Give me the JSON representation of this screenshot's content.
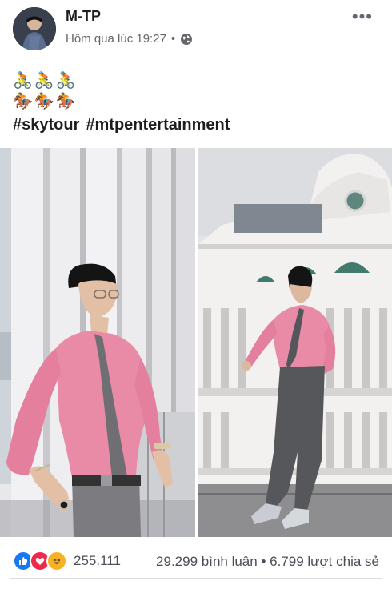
{
  "post": {
    "author": "M-TP",
    "timestamp": "Hôm qua lúc 19:27",
    "separator": "•",
    "privacy_icon": "globe-icon",
    "more_icon": "more-icon",
    "more_label": "•••",
    "emoji_line_1": "🚴🚴🚴",
    "emoji_line_2": "🏇🏇🏇",
    "hashtags": [
      "#skytour",
      "#mtpentertainment"
    ]
  },
  "reactions": {
    "icons": [
      "like-icon",
      "love-icon",
      "haha-icon"
    ],
    "count": "255.111",
    "comments_shares": "29.299 bình luận • 6.799 lượt chia sẻ"
  },
  "colors": {
    "like": "#1877f2",
    "love": "#f0284a",
    "haha": "#f7b125",
    "shirt": "#e98aa6"
  }
}
